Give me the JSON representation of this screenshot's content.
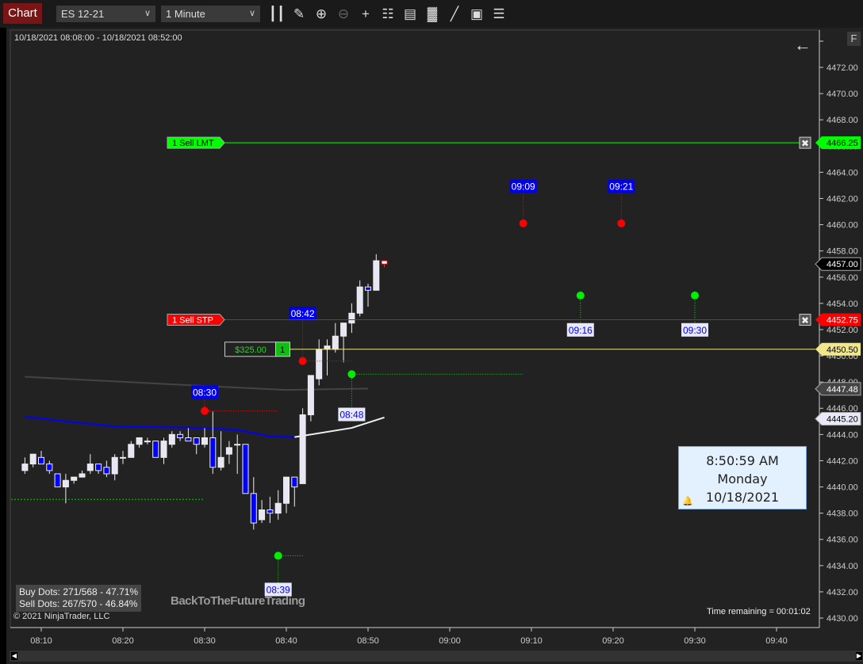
{
  "toolbar": {
    "tab_label": "Chart",
    "instrument": "ES 12-21",
    "interval": "1 Minute",
    "icons": [
      "bar-type-icon",
      "drawing-tools-icon",
      "zoom-in-icon",
      "zoom-out-icon",
      "crosshair-icon",
      "data-box-icon",
      "chart-trader-icon",
      "indicators-icon",
      "strategies-icon",
      "templates-icon",
      "properties-icon"
    ]
  },
  "chart": {
    "date_range": "10/18/2021 08:08:00 - 10/18/2021 08:52:00",
    "f_button": "F",
    "copyright": "© 2021 NinjaTrader, LLC",
    "watermark": "BackToTheFutureTrading",
    "time_remaining": "Time remaining = 00:01:02",
    "stats": {
      "buy": "Buy Dots: 271/568 - 47.71%",
      "sell": "Sell Dots: 267/570 - 46.84%"
    },
    "clock": {
      "time": "8:50:59 AM",
      "day": "Monday",
      "date": "10/18/2021"
    },
    "colors": {
      "background": "#222222",
      "up": "#e6e6f5",
      "down": "#0000ff",
      "buy_dot": "#00ee00",
      "sell_dot": "#ff0000",
      "limit": "#00ff00",
      "stop": "#ff0000",
      "position": "#f0e68c"
    }
  },
  "chart_data": {
    "type": "candlestick",
    "y_ticks": [
      "4430.00",
      "4432.00",
      "4434.00",
      "4436.00",
      "4438.00",
      "4440.00",
      "4442.00",
      "4444.00",
      "4446.00",
      "4448.00",
      "4450.00",
      "4452.00",
      "4454.00",
      "4456.00",
      "4458.00",
      "4460.00",
      "4462.00",
      "4464.00",
      "4466.00",
      "4468.00",
      "4470.00",
      "4472.00"
    ],
    "x_ticks": [
      "08:10",
      "08:20",
      "08:30",
      "08:40",
      "08:50",
      "09:00",
      "09:10",
      "09:20",
      "09:30",
      "09:40"
    ],
    "ylim": [
      4429,
      4475
    ],
    "candles_columns": [
      "time",
      "open",
      "high",
      "low",
      "close"
    ],
    "candles": [
      [
        "08:08",
        4441.25,
        4442.25,
        4441.0,
        4441.75
      ],
      [
        "08:09",
        4441.75,
        4442.5,
        4441.5,
        4442.5
      ],
      [
        "08:10",
        4442.25,
        4442.75,
        4441.75,
        4441.75
      ],
      [
        "08:11",
        4441.75,
        4442.0,
        4441.0,
        4441.25
      ],
      [
        "08:12",
        4441.0,
        4441.0,
        4440.0,
        4440.0
      ],
      [
        "08:13",
        4440.0,
        4441.0,
        4438.75,
        4440.5
      ],
      [
        "08:14",
        4440.5,
        4440.75,
        4440.25,
        4440.75
      ],
      [
        "08:15",
        4440.75,
        4441.25,
        4440.75,
        4441.0
      ],
      [
        "08:16",
        4441.25,
        4442.5,
        4441.0,
        4441.75
      ],
      [
        "08:17",
        4441.75,
        4441.75,
        4441.0,
        4441.25
      ],
      [
        "08:18",
        4441.5,
        4442.0,
        4440.75,
        4441.0
      ],
      [
        "08:19",
        4441.0,
        4442.5,
        4440.5,
        4442.25
      ],
      [
        "08:20",
        4442.25,
        4442.75,
        4441.75,
        4442.25
      ],
      [
        "08:21",
        4442.25,
        4443.5,
        4442.25,
        4443.25
      ],
      [
        "08:22",
        4443.25,
        4443.75,
        4443.0,
        4443.75
      ],
      [
        "08:23",
        4443.5,
        4443.75,
        4443.25,
        4443.5
      ],
      [
        "08:24",
        4443.5,
        4443.5,
        4442.25,
        4442.25
      ],
      [
        "08:25",
        4442.25,
        4443.75,
        4441.75,
        4443.5
      ],
      [
        "08:26",
        4443.25,
        4444.25,
        4443.0,
        4444.0
      ],
      [
        "08:27",
        4444.0,
        4444.25,
        4443.5,
        4443.75
      ],
      [
        "08:28",
        4443.75,
        4444.5,
        4443.5,
        4443.5
      ],
      [
        "08:29",
        4443.75,
        4443.75,
        4442.5,
        4443.25
      ],
      [
        "08:30",
        4443.25,
        4444.5,
        4443.0,
        4443.75
      ],
      [
        "08:31",
        4443.75,
        4445.75,
        4441.0,
        4441.5
      ],
      [
        "08:32",
        4441.5,
        4444.25,
        4441.25,
        4442.25
      ],
      [
        "08:33",
        4442.5,
        4443.5,
        4441.75,
        4443.0
      ],
      [
        "08:34",
        4443.25,
        4444.0,
        4441.0,
        4443.25
      ],
      [
        "08:35",
        4443.25,
        4443.25,
        4439.5,
        4439.5
      ],
      [
        "08:36",
        4439.5,
        4440.75,
        4436.75,
        4437.25
      ],
      [
        "08:37",
        4437.5,
        4439.0,
        4437.25,
        4438.25
      ],
      [
        "08:38",
        4438.25,
        4439.25,
        4437.25,
        4438.0
      ],
      [
        "08:39",
        4438.0,
        4439.75,
        4437.5,
        4438.75
      ],
      [
        "08:40",
        4438.75,
        4440.75,
        4438.0,
        4440.75
      ],
      [
        "08:41",
        4440.75,
        4440.75,
        4438.5,
        4440.0
      ],
      [
        "08:42",
        4440.25,
        4446.0,
        4440.25,
        4445.5
      ],
      [
        "08:43",
        4445.5,
        4448.5,
        4445.0,
        4448.5
      ],
      [
        "08:44",
        4448.25,
        4451.25,
        4447.75,
        4450.5
      ],
      [
        "08:45",
        4450.5,
        4451.25,
        4448.5,
        4450.75
      ],
      [
        "08:46",
        4450.5,
        4452.5,
        4450.25,
        4451.5
      ],
      [
        "08:47",
        4451.5,
        4452.5,
        4449.5,
        4452.5
      ],
      [
        "08:48",
        4452.5,
        4454.0,
        4451.75,
        4453.25
      ],
      [
        "08:49",
        4453.25,
        4455.75,
        4453.0,
        4455.25
      ],
      [
        "08:50",
        4455.25,
        4455.5,
        4453.75,
        4455.0
      ],
      [
        "08:51",
        4455.0,
        4457.75,
        4455.0,
        4457.25
      ],
      [
        "08:52",
        4457.25,
        4457.25,
        4456.75,
        4457.0
      ]
    ],
    "ma_fast": {
      "points": [
        [
          "08:08",
          4445.35
        ],
        [
          "08:19",
          4444.6
        ],
        [
          "08:30",
          4444.5
        ],
        [
          "08:34",
          4444.35
        ],
        [
          "08:38",
          4443.85
        ],
        [
          "08:41",
          4443.8
        ],
        [
          "08:48",
          4444.5
        ],
        [
          "08:52",
          4445.3
        ]
      ],
      "down_color": "#0000ff",
      "up_color": "#f0f0f0",
      "turn": "08:41",
      "last_label": "4445.20"
    },
    "ma_slow": {
      "points": [
        [
          "08:08",
          4448.4
        ],
        [
          "08:30",
          4447.7
        ],
        [
          "08:40",
          4447.4
        ],
        [
          "08:50",
          4447.5
        ]
      ],
      "color": "#444444",
      "last_label": "4447.48"
    },
    "last_price": "4457.00",
    "orders": [
      {
        "qty": "1",
        "label": "Sell LMT",
        "price": 4466.25,
        "price_label": "4466.25",
        "color": "#00ff00",
        "text_color": "#000000"
      },
      {
        "qty": "1",
        "label": "Sell STP",
        "price": 4452.75,
        "price_label": "4452.75",
        "color": "#ff0000",
        "text_color": "#ffffff"
      }
    ],
    "position": {
      "pnl": "$325.00",
      "qty": "1",
      "price": 4450.5,
      "price_label": "4450.50"
    },
    "sell_dots": [
      {
        "time": "08:30",
        "price": 4445.8,
        "label": "08:30",
        "label_price": 4447.2,
        "line_to": "08:39"
      },
      {
        "time": "08:42",
        "price": 4449.6,
        "label": "08:42",
        "label_price": 4453.2,
        "line_to": "08:48"
      },
      {
        "time": "09:09",
        "price": 4460.1,
        "label": "09:09",
        "label_price": 4462.9
      },
      {
        "time": "09:21",
        "price": 4460.1,
        "label": "09:21",
        "label_price": 4462.9
      }
    ],
    "buy_dots": [
      {
        "time": "08:39",
        "price": 4434.75,
        "label": "08:39",
        "label_price": 4432.15,
        "line_to": "08:42"
      },
      {
        "time": "08:48",
        "price": 4448.6,
        "label": "08:48",
        "label_price": 4445.5,
        "line_to": "09:09"
      },
      {
        "time": "09:16",
        "price": 4454.6,
        "label": "09:16",
        "label_price": 4451.95
      },
      {
        "time": "09:30",
        "price": 4454.6,
        "label": "09:30",
        "label_price": 4451.95
      }
    ],
    "support_line": {
      "price": 4439.05,
      "from": "08:00",
      "to": "08:30",
      "color": "#00cc00"
    }
  }
}
